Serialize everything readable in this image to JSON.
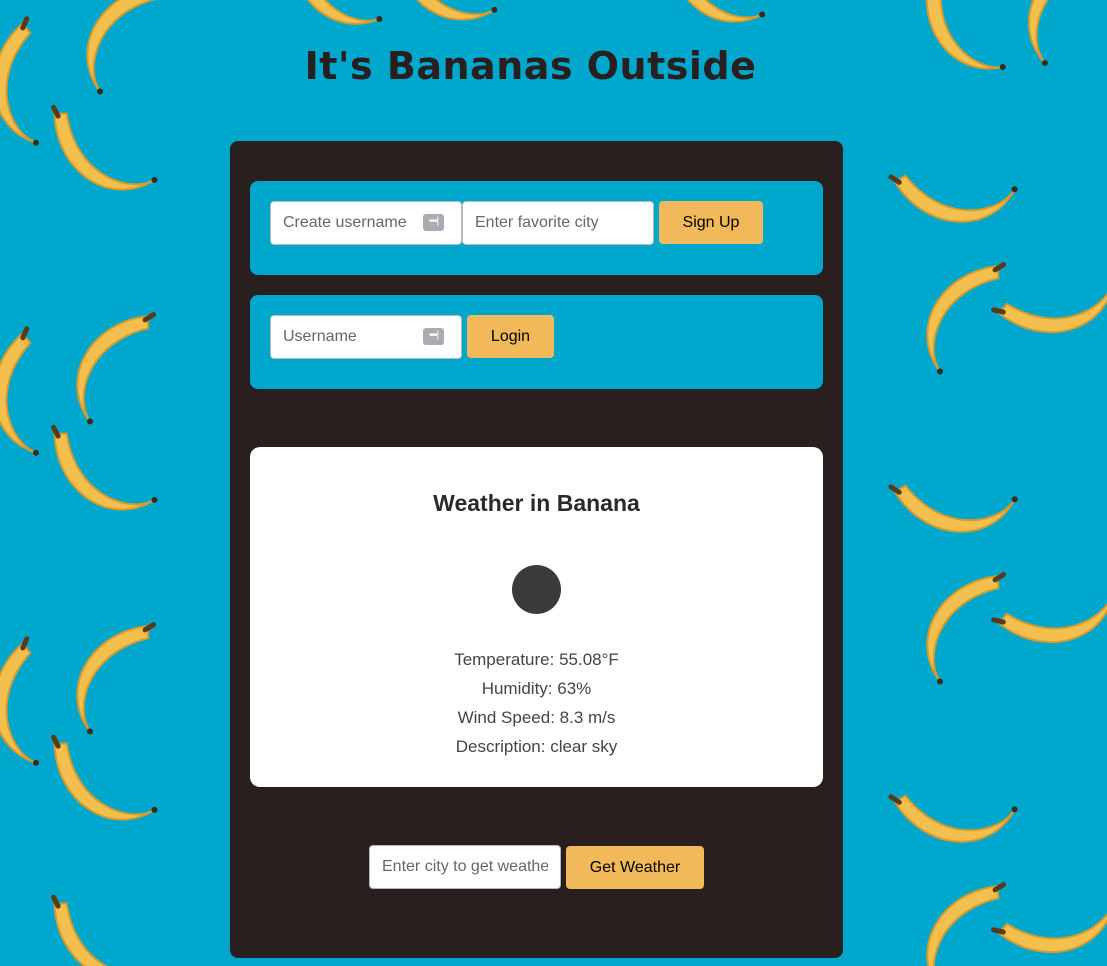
{
  "header": {
    "title": "It's Bananas Outside"
  },
  "signup": {
    "username_placeholder": "Create username",
    "city_placeholder": "Enter favorite city",
    "button_label": "Sign Up"
  },
  "login": {
    "username_placeholder": "Username",
    "button_label": "Login"
  },
  "weather": {
    "title": "Weather in Banana",
    "temperature": "Temperature: 55.08°F",
    "humidity": "Humidity: 63%",
    "wind_speed": "Wind Speed: 8.3 m/s",
    "description": "Description: clear sky"
  },
  "search": {
    "city_placeholder": "Enter city to get weather",
    "button_label": "Get Weather"
  },
  "colors": {
    "background": "#00a7cd",
    "panel": "#2a1f1f",
    "accent_button": "#f1b95a",
    "banana": "#f3c04f"
  }
}
